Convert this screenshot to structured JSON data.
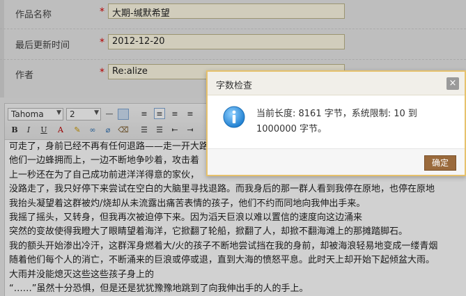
{
  "form": {
    "fields": [
      {
        "label": "作品名称",
        "required": "*",
        "value": "大期-缄默希望"
      },
      {
        "label": "最后更新时间",
        "required": "*",
        "value": "2012-12-20"
      },
      {
        "label": "作者",
        "required": "*",
        "value": "Re:alize"
      }
    ]
  },
  "editor": {
    "font_family": "Tahoma",
    "font_size": "2",
    "buttons": {
      "bold": "B",
      "italic": "I",
      "underline": "U"
    },
    "lines": [
      "可走了，身前已经不再有任何退路——走一开大路，放开心，",
      "他们一边蜂拥而上，一边不断地争吵着，攻击着",
      "上一秒还在为了自己成功前进洋洋得意的家伙，",
      "没路走了，我只好停下来尝试在空白的大脑里寻找退路。而我身后的那一群人看到我停在原地，也停在原地",
      "我抬头凝望着这群被灼/烧却从未流露出痛苦表情的孩子，他们不约而同地向我伸出手来。",
      "我摇了摇头，又转身，但我再次被迫停下来。因为滔天巨浪以难以置信的速度向这边涌来",
      "突然的变故使得我瞪大了眼睛望着海洋，它掀翻了轮船，掀翻了人，却掀不翻海滩上的那摊踏脚石。",
      "我的额头开始渗出冷汗，这群浑身燃着大/火的孩子不断地尝试挡在我的身前，却被海浪轻易地变成一缕青烟",
      "随着他们每个人的消亡，不断涌来的巨浪或停或退，直到大海的愤怒平息。此时天上却开始下起倾盆大雨。",
      "大雨并没能熄灭这些这些孩子身上的",
      "“……”虽然十分恐惧，但是还是犹犹豫豫地跳到了向我伸出手的人的手上。"
    ]
  },
  "dialog": {
    "title": "字数检查",
    "close": "×",
    "message": "当前长度: 8161 字节，系统限制: 10 到 1000000 字节。",
    "ok_label": "确定"
  },
  "colors": {
    "dialog_border": "#e6c16c",
    "ok_button": "#9a6a3c",
    "required": "#dd0000",
    "input_bg": "#fffbe6"
  }
}
